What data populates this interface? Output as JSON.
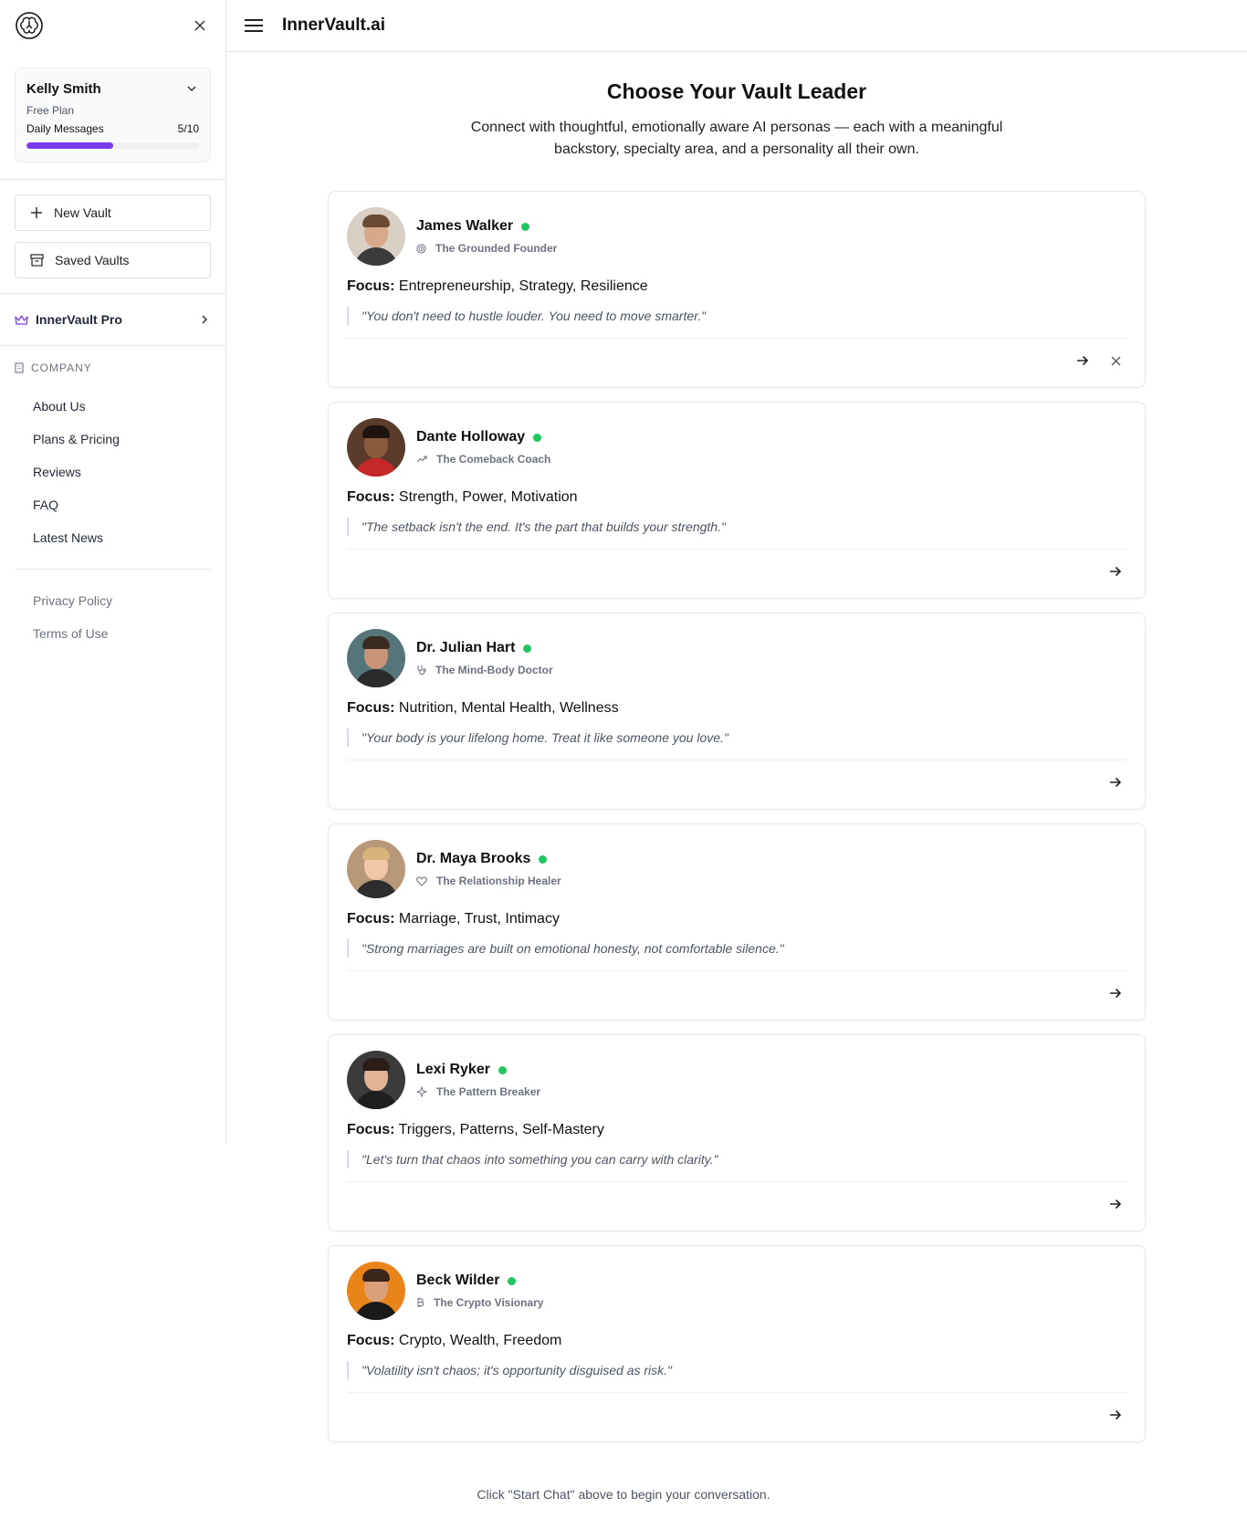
{
  "app": {
    "title": "InnerVault.ai"
  },
  "user": {
    "name": "Kelly Smith",
    "plan": "Free Plan",
    "daily_label": "Daily Messages",
    "daily_count": "5/10",
    "daily_progress": 0.5
  },
  "sidebar": {
    "new_vault": "New Vault",
    "saved_vaults": "Saved Vaults",
    "pro_label": "InnerVault Pro",
    "company_heading": "COMPANY",
    "company_links": [
      "About Us",
      "Plans & Pricing",
      "Reviews",
      "FAQ",
      "Latest News"
    ],
    "legal_links": [
      "Privacy Policy",
      "Terms of Use"
    ]
  },
  "main": {
    "title": "Choose Your Vault Leader",
    "subtitle": "Connect with thoughtful, emotionally aware AI personas — each with a meaningful backstory, specialty area, and a personality all their own.",
    "focus_label": "Focus:",
    "footer_note": "Click \"Start Chat\" above to begin your conversation."
  },
  "personas": [
    {
      "name": "James Walker",
      "title": "The Grounded Founder",
      "title_icon": "target-icon",
      "focus": "Entrepreneurship, Strategy, Resilience",
      "quote": "\"You don't need to hustle louder. You need to move smarter.\"",
      "has_dismiss": true,
      "colors": {
        "bg": "#d9cfc4",
        "skin": "#d8a88a",
        "hair": "#6b4a34",
        "shirt": "#3b3b3b"
      }
    },
    {
      "name": "Dante Holloway",
      "title": "The Comeback Coach",
      "title_icon": "trending-up-icon",
      "focus": "Strength, Power, Motivation",
      "quote": "\"The setback isn't the end. It's the part that builds your strength.\"",
      "has_dismiss": false,
      "colors": {
        "bg": "#5a3b2c",
        "skin": "#8a5a3c",
        "hair": "#1d1410",
        "shirt": "#c62828"
      }
    },
    {
      "name": "Dr. Julian Hart",
      "title": "The Mind-Body Doctor",
      "title_icon": "stethoscope-icon",
      "focus": "Nutrition, Mental Health, Wellness",
      "quote": "\"Your body is your lifelong home. Treat it like someone you love.\"",
      "has_dismiss": false,
      "colors": {
        "bg": "#55757a",
        "skin": "#c99477",
        "hair": "#3a2a20",
        "shirt": "#2b2b2b"
      }
    },
    {
      "name": "Dr. Maya Brooks",
      "title": "The Relationship Healer",
      "title_icon": "heart-icon",
      "focus": "Marriage, Trust, Intimacy",
      "quote": "\"Strong marriages are built on emotional honesty, not comfortable silence.\"",
      "has_dismiss": false,
      "colors": {
        "bg": "#b89878",
        "skin": "#f0c8a8",
        "hair": "#d7b27a",
        "shirt": "#2d2d2d"
      }
    },
    {
      "name": "Lexi Ryker",
      "title": "The Pattern Breaker",
      "title_icon": "sparkle-icon",
      "focus": "Triggers, Patterns, Self-Mastery",
      "quote": "\"Let's turn that chaos into something you can carry with clarity.\"",
      "has_dismiss": false,
      "colors": {
        "bg": "#3b3b3b",
        "skin": "#e2b395",
        "hair": "#2a1d17",
        "shirt": "#1f1f1f"
      }
    },
    {
      "name": "Beck Wilder",
      "title": "The Crypto Visionary",
      "title_icon": "bitcoin-icon",
      "focus": "Crypto, Wealth, Freedom",
      "quote": "\"Volatility isn't chaos; it's opportunity disguised as risk.\"",
      "has_dismiss": false,
      "colors": {
        "bg": "#e8841a",
        "skin": "#d9a07a",
        "hair": "#3b261a",
        "shirt": "#1a1a1a"
      }
    }
  ]
}
